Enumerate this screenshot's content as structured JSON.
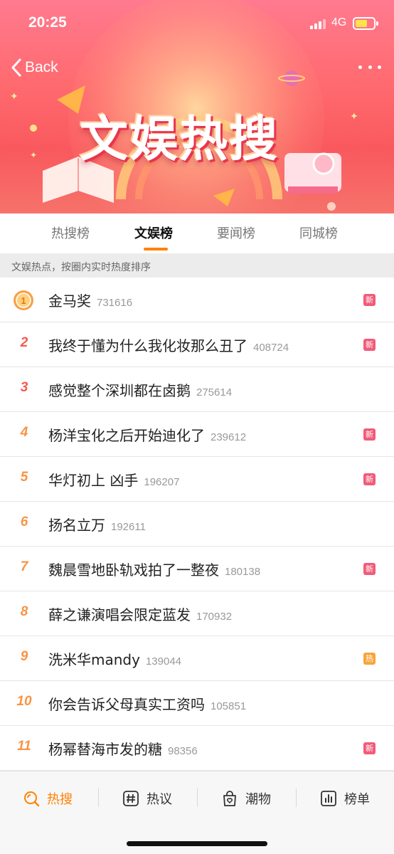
{
  "status": {
    "time": "20:25",
    "network": "4G"
  },
  "nav": {
    "back_label": "Back"
  },
  "banner": {
    "title": "文娱热搜"
  },
  "tabs": [
    {
      "label": "热搜榜",
      "active": false
    },
    {
      "label": "文娱榜",
      "active": true
    },
    {
      "label": "要闻榜",
      "active": false
    },
    {
      "label": "同城榜",
      "active": false
    }
  ],
  "subheader": "文娱热点，按圈内实时热度排序",
  "list": [
    {
      "rank": "1",
      "title": "金马奖",
      "count": "731616",
      "badge": "新",
      "badge_type": "new"
    },
    {
      "rank": "2",
      "title": "我终于懂为什么我化妆那么丑了",
      "count": "408724",
      "badge": "新",
      "badge_type": "new"
    },
    {
      "rank": "3",
      "title": "感觉整个深圳都在卤鹅",
      "count": "275614",
      "badge": "",
      "badge_type": ""
    },
    {
      "rank": "4",
      "title": "杨洋宝化之后开始迪化了",
      "count": "239612",
      "badge": "新",
      "badge_type": "new"
    },
    {
      "rank": "5",
      "title": "华灯初上 凶手",
      "count": "196207",
      "badge": "新",
      "badge_type": "new"
    },
    {
      "rank": "6",
      "title": "扬名立万",
      "count": "192611",
      "badge": "",
      "badge_type": ""
    },
    {
      "rank": "7",
      "title": "魏晨雪地卧轨戏拍了一整夜",
      "count": "180138",
      "badge": "新",
      "badge_type": "new"
    },
    {
      "rank": "8",
      "title": "薛之谦演唱会限定蓝发",
      "count": "170932",
      "badge": "",
      "badge_type": ""
    },
    {
      "rank": "9",
      "title": "洗米华mandy",
      "count": "139044",
      "badge": "热",
      "badge_type": "hot"
    },
    {
      "rank": "10",
      "title": "你会告诉父母真实工资吗",
      "count": "105851",
      "badge": "",
      "badge_type": ""
    },
    {
      "rank": "11",
      "title": "杨幂替海市发的糖",
      "count": "98356",
      "badge": "新",
      "badge_type": "new"
    }
  ],
  "bottom_nav": [
    {
      "label": "热搜",
      "icon": "search-icon",
      "active": true
    },
    {
      "label": "热议",
      "icon": "hashtag-icon",
      "active": false
    },
    {
      "label": "潮物",
      "icon": "shopping-bag-icon",
      "active": false
    },
    {
      "label": "榜单",
      "icon": "chart-icon",
      "active": false
    }
  ],
  "colors": {
    "accent": "#ff8200",
    "new_badge": "#f25b79",
    "hot_badge": "#f7a53a",
    "rank_top": "#f35a4f",
    "rank_mid": "#f79445"
  }
}
